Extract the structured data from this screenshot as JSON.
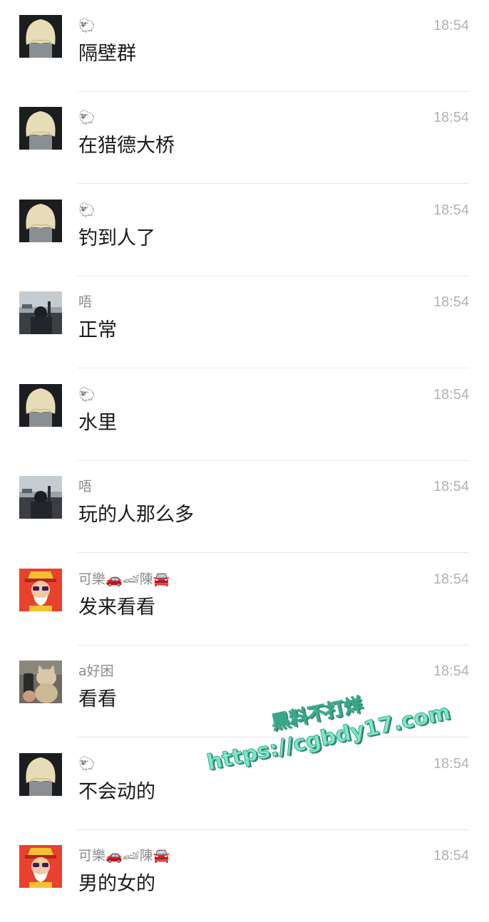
{
  "messages": [
    {
      "sender": "🐑",
      "time": "18:54",
      "text": "隔壁群",
      "avatar": "blonde-bob-avatar"
    },
    {
      "sender": "🐑",
      "time": "18:54",
      "text": "在猎德大桥",
      "avatar": "blonde-bob-avatar"
    },
    {
      "sender": "🐑",
      "time": "18:54",
      "text": "钓到人了",
      "avatar": "blonde-bob-avatar"
    },
    {
      "sender": "唔",
      "time": "18:54",
      "text": "正常",
      "avatar": "car-photo-avatar"
    },
    {
      "sender": "🐑",
      "time": "18:54",
      "text": "水里",
      "avatar": "blonde-bob-avatar"
    },
    {
      "sender": "唔",
      "time": "18:54",
      "text": "玩的人那么多",
      "avatar": "car-photo-avatar"
    },
    {
      "sender": "可樂🚗🏎陳🚘",
      "time": "18:54",
      "text": "发来看看",
      "avatar": "cartoon-god-avatar"
    },
    {
      "sender": "a好困",
      "time": "18:54",
      "text": "看看",
      "avatar": "cat-photo-avatar"
    },
    {
      "sender": "🐑",
      "time": "18:54",
      "text": "不会动的",
      "avatar": "blonde-bob-avatar"
    },
    {
      "sender": "可樂🚗🏎陳🚘",
      "time": "18:54",
      "text": "男的女的",
      "avatar": "cartoon-god-avatar"
    }
  ],
  "watermark": {
    "line1": "黑料不打烊",
    "line2": "https://cgbdy17.com"
  },
  "colors": {
    "background": "#ffffff",
    "text": "#1a1a1a",
    "sender": "#8c8c8c",
    "time": "#b2b2b2",
    "divider": "#e6e6e6",
    "watermark": "#7ee8c8"
  }
}
